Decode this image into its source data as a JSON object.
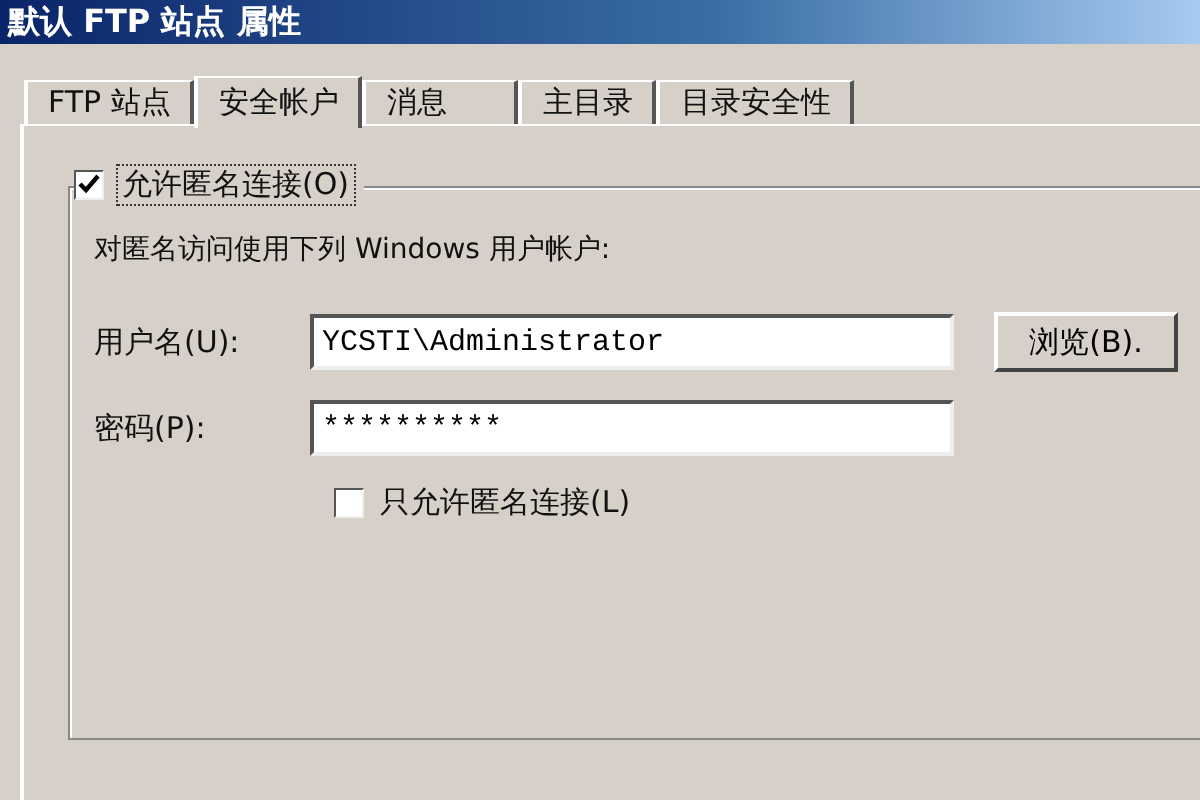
{
  "window": {
    "title": "默认 FTP 站点 属性"
  },
  "tabs": [
    {
      "label": "FTP 站点",
      "selected": false
    },
    {
      "label": "安全帐户",
      "selected": true
    },
    {
      "label": "消息",
      "selected": false
    },
    {
      "label": "主目录",
      "selected": false
    },
    {
      "label": "目录安全性",
      "selected": false
    }
  ],
  "group": {
    "label": "允许匿名连接(O)",
    "checked": true,
    "description": "对匿名访问使用下列 Windows 用户帐户:"
  },
  "username": {
    "label": "用户名(U):",
    "value": "YCSTI\\Administrator"
  },
  "password": {
    "label": "密码(P):",
    "value": "**********"
  },
  "browse_button": "浏览(B).",
  "only_anonymous": {
    "label": "只允许匿名连接(L)",
    "checked": false
  }
}
